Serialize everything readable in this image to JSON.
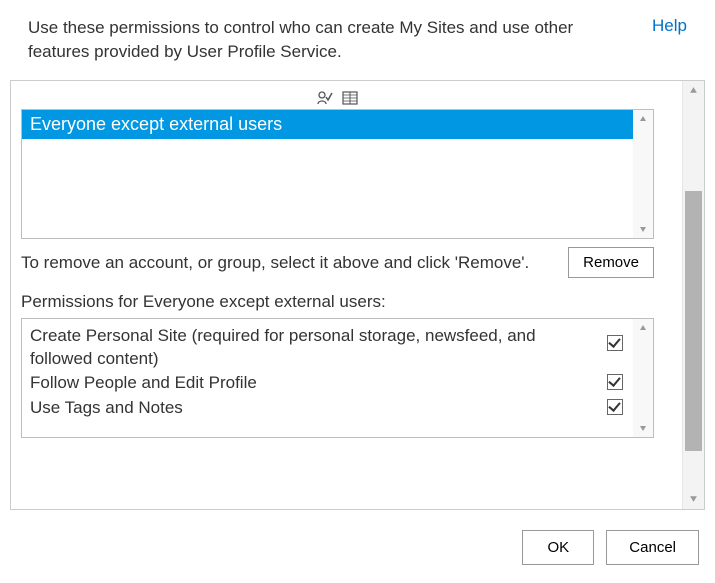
{
  "header": {
    "description": "Use these permissions to control who can create My Sites and use other features provided by User Profile Service.",
    "help_label": "Help"
  },
  "userlist": {
    "items": [
      {
        "label": "Everyone except external users",
        "selected": true
      }
    ]
  },
  "remove_hint": "To remove an account, or group, select it above and click 'Remove'.",
  "remove_button_label": "Remove",
  "permissions_heading": "Permissions for Everyone except external users:",
  "permissions": [
    {
      "label": "Create Personal Site (required for personal storage, newsfeed, and followed content)",
      "checked": true
    },
    {
      "label": "Follow People and Edit Profile",
      "checked": true
    },
    {
      "label": "Use Tags and Notes",
      "checked": true
    }
  ],
  "footer": {
    "ok_label": "OK",
    "cancel_label": "Cancel"
  }
}
